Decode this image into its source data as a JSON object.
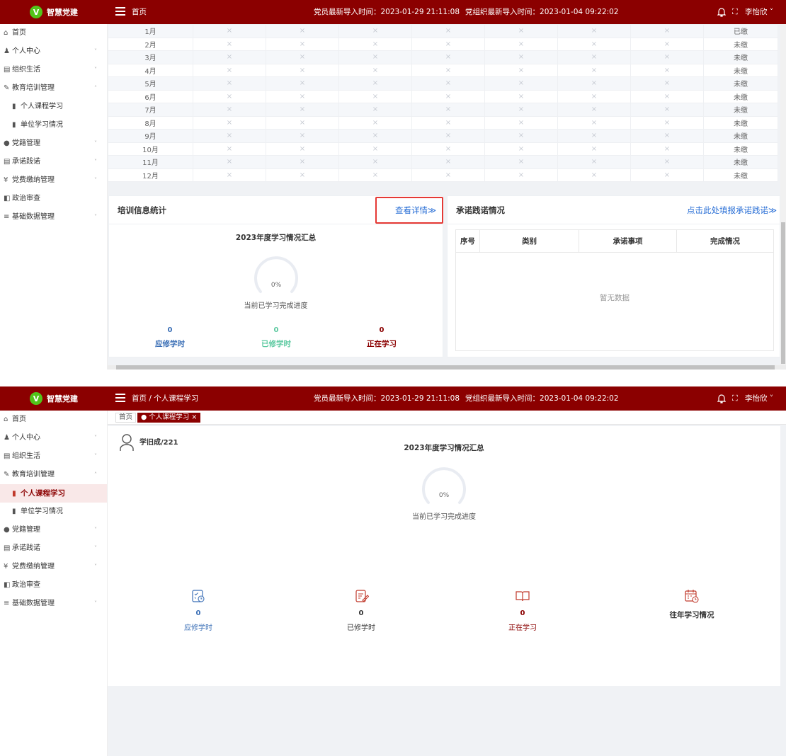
{
  "app": {
    "logo_letter": "V",
    "name": "智慧党建",
    "member_import_time": "党员最新导入时间：2023-01-29 21:11:08",
    "org_import_time": "党组织最新导入时间：2023-01-04 09:22:02",
    "fullscreen_glyph": "⛶",
    "user_name": "李怡欣",
    "user_caret": "˅"
  },
  "sidebar": {
    "items": [
      {
        "label": "首页",
        "icon": "home-icon",
        "glyph": "⌂"
      },
      {
        "label": "个人中心",
        "icon": "person-icon",
        "glyph": "♟",
        "caret": "˅"
      },
      {
        "label": "组织生活",
        "icon": "folder-icon",
        "glyph": "▤",
        "caret": "˅"
      },
      {
        "label": "教育培训管理",
        "icon": "edit-icon",
        "glyph": "✎",
        "caret": "˄"
      },
      {
        "label": "个人课程学习",
        "icon": "book-icon",
        "glyph": "▮"
      },
      {
        "label": "单位学习情况",
        "icon": "bar-chart-icon",
        "glyph": "▮"
      },
      {
        "label": "党籍管理",
        "icon": "badge-icon",
        "glyph": "●",
        "caret": "˅"
      },
      {
        "label": "承诺践诺",
        "icon": "doc-icon",
        "glyph": "▤",
        "caret": "˅"
      },
      {
        "label": "党费缴纳管理",
        "icon": "yen-icon",
        "glyph": "¥",
        "caret": "˅"
      },
      {
        "label": "政治审查",
        "icon": "review-icon",
        "glyph": "◧"
      },
      {
        "label": "基础数据管理",
        "icon": "list-icon",
        "glyph": "≡",
        "caret": "˅"
      }
    ]
  },
  "top": {
    "breadcrumb": "首页",
    "fee_rows": [
      {
        "month": "1月",
        "status": "已缴"
      },
      {
        "month": "2月",
        "status": "未缴"
      },
      {
        "month": "3月",
        "status": "未缴"
      },
      {
        "month": "4月",
        "status": "未缴"
      },
      {
        "month": "5月",
        "status": "未缴"
      },
      {
        "month": "6月",
        "status": "未缴"
      },
      {
        "month": "7月",
        "status": "未缴"
      },
      {
        "month": "8月",
        "status": "未缴"
      },
      {
        "month": "9月",
        "status": "未缴"
      },
      {
        "month": "10月",
        "status": "未缴"
      },
      {
        "month": "11月",
        "status": "未缴"
      },
      {
        "month": "12月",
        "status": "未缴"
      }
    ],
    "empty_cell": "×",
    "training": {
      "title": "培训信息统计",
      "details_link": "查看详情≫",
      "summary_title": "2023年度学习情况汇总",
      "progress": "0%",
      "progress_label": "当前已学习完成进度",
      "required_hours": "0",
      "required_label": "应修学时",
      "completed_hours": "0",
      "completed_label": "已修学时",
      "in_progress": "0",
      "in_progress_label": "正在学习"
    },
    "pledge": {
      "title": "承诺践诺情况",
      "report_link": "点击此处填报承诺践诺≫",
      "columns": [
        "序号",
        "类别",
        "承诺事项",
        "完成情况"
      ],
      "no_data": "暂无数据"
    }
  },
  "bottom": {
    "breadcrumb": "首页 / 个人课程学习",
    "tabs": [
      {
        "label": "首页"
      },
      {
        "label": "● 个人课程学习 ×"
      }
    ],
    "user_id": "学旧成/221",
    "summary_title": "2023年度学习情况汇总",
    "progress": "0%",
    "progress_label": "当前已学习完成进度",
    "required_hours": "0",
    "required_label": "应修学时",
    "completed_hours": "0",
    "completed_label": "已修学时",
    "in_progress": "0",
    "in_progress_label": "正在学习",
    "history_label": "往年学习情况"
  },
  "colors": {
    "brand": "#8b0000",
    "link": "#2a6fd6",
    "required": "#3b6fb6",
    "completed": "#5cc9a0",
    "in_progress": "#8b0000"
  }
}
